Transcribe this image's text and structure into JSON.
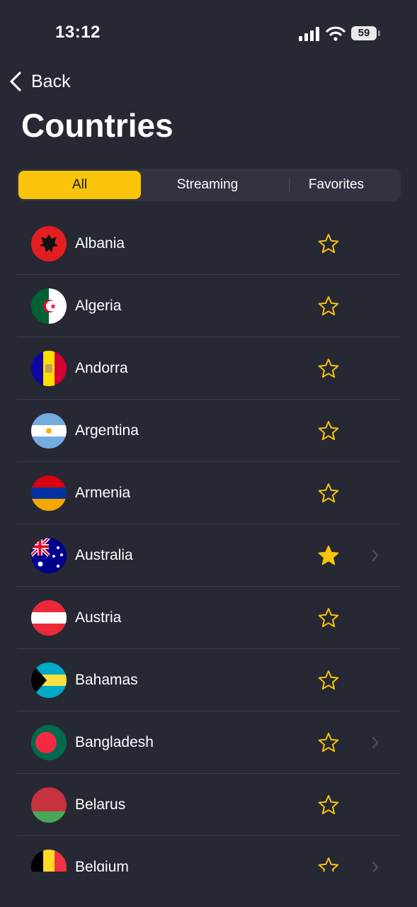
{
  "status_bar": {
    "time": "13:12",
    "battery": "59"
  },
  "nav": {
    "back_label": "Back"
  },
  "page": {
    "title": "Countries"
  },
  "tabs": [
    {
      "label": "All",
      "active": true
    },
    {
      "label": "Streaming",
      "active": false
    },
    {
      "label": "Favorites",
      "active": false
    }
  ],
  "colors": {
    "accent": "#f9c40a",
    "background": "#262834",
    "segment_bg": "#31333f",
    "divider": "#3a3c48"
  },
  "countries": [
    {
      "name": "Albania",
      "flag": "albania-flag",
      "favorite": false,
      "chevron": false
    },
    {
      "name": "Algeria",
      "flag": "algeria-flag",
      "favorite": false,
      "chevron": false
    },
    {
      "name": "Andorra",
      "flag": "andorra-flag",
      "favorite": false,
      "chevron": false
    },
    {
      "name": "Argentina",
      "flag": "argentina-flag",
      "favorite": false,
      "chevron": false
    },
    {
      "name": "Armenia",
      "flag": "armenia-flag",
      "favorite": false,
      "chevron": false
    },
    {
      "name": "Australia",
      "flag": "australia-flag",
      "favorite": true,
      "chevron": true
    },
    {
      "name": "Austria",
      "flag": "austria-flag",
      "favorite": false,
      "chevron": false
    },
    {
      "name": "Bahamas",
      "flag": "bahamas-flag",
      "favorite": false,
      "chevron": false
    },
    {
      "name": "Bangladesh",
      "flag": "bangladesh-flag",
      "favorite": false,
      "chevron": true
    },
    {
      "name": "Belarus",
      "flag": "belarus-flag",
      "favorite": false,
      "chevron": false
    },
    {
      "name": "Belgium",
      "flag": "belgium-flag",
      "favorite": false,
      "chevron": true
    }
  ]
}
